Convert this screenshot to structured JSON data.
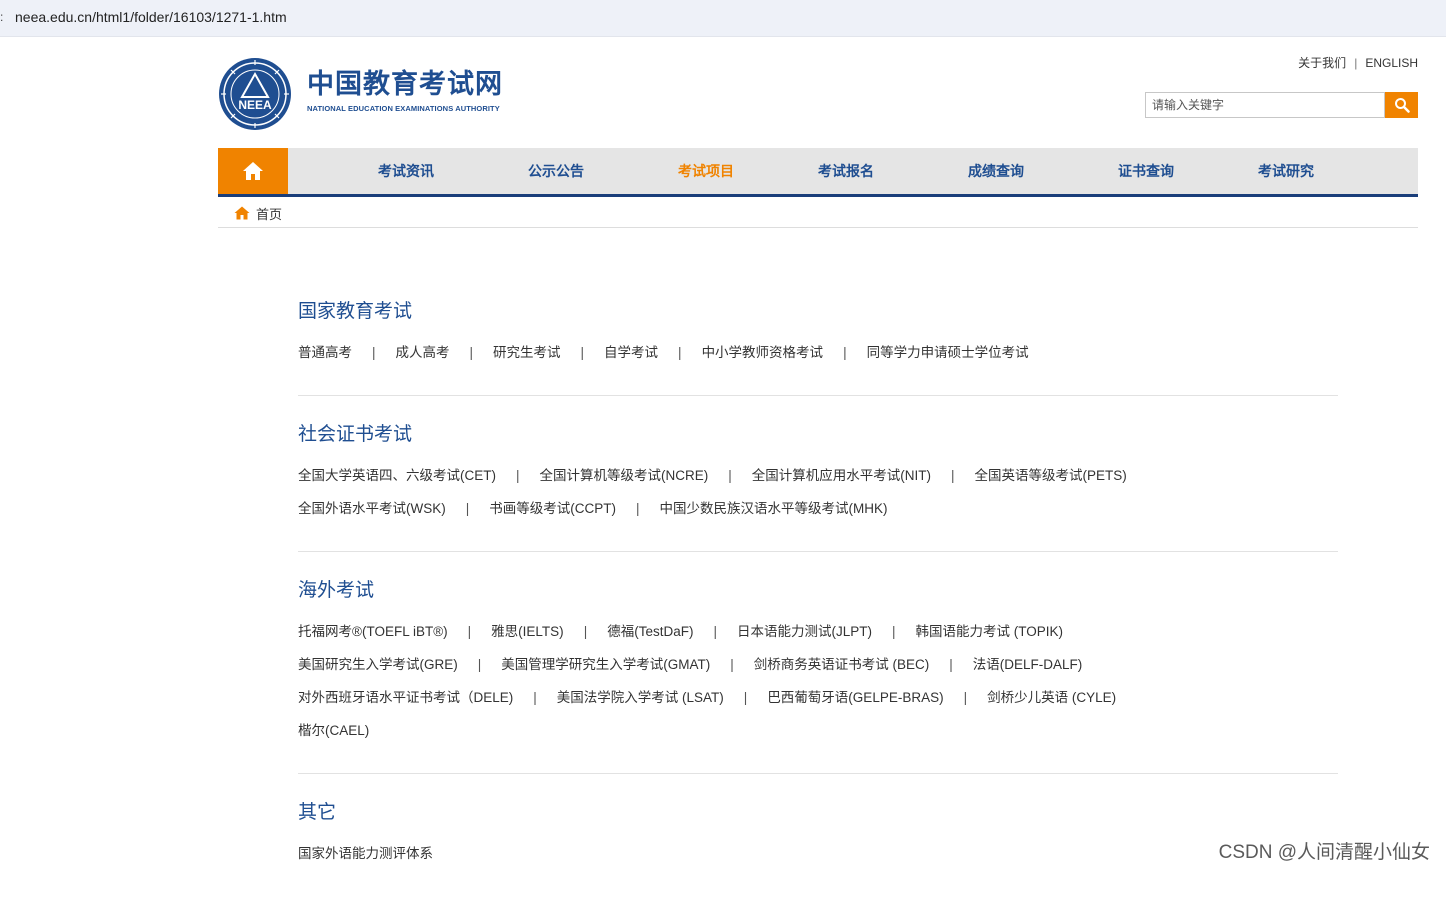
{
  "browser": {
    "url": "neea.edu.cn/html1/folder/16103/1271-1.htm"
  },
  "header": {
    "logo_cn": "中国教育考试网",
    "logo_en": "NATIONAL EDUCATION EXAMINATIONS AUTHORITY",
    "emblem_letters": "NEEA",
    "links": {
      "about": "关于我们",
      "separator": "|",
      "english": "ENGLISH"
    },
    "search": {
      "placeholder": "请输入关键字"
    }
  },
  "nav": {
    "items": [
      {
        "label": "考试资讯"
      },
      {
        "label": "公示公告"
      },
      {
        "label": "考试项目",
        "active": true
      },
      {
        "label": "考试报名"
      },
      {
        "label": "成绩查询"
      },
      {
        "label": "证书查询"
      },
      {
        "label": "考试研究"
      }
    ]
  },
  "breadcrumb": {
    "home": "首页"
  },
  "sections": [
    {
      "title": "国家教育考试",
      "rows": [
        [
          "普通高考",
          "成人高考",
          "研究生考试",
          "自学考试",
          "中小学教师资格考试",
          "同等学力申请硕士学位考试"
        ]
      ]
    },
    {
      "title": "社会证书考试",
      "rows": [
        [
          "全国大学英语四、六级考试(CET)",
          "全国计算机等级考试(NCRE)",
          "全国计算机应用水平考试(NIT)",
          "全国英语等级考试(PETS)"
        ],
        [
          "全国外语水平考试(WSK)",
          "书画等级考试(CCPT)",
          "中国少数民族汉语水平等级考试(MHK)"
        ]
      ]
    },
    {
      "title": "海外考试",
      "rows": [
        [
          "托福网考®(TOEFL iBT®)",
          "雅思(IELTS)",
          "德福(TestDaF)",
          "日本语能力测试(JLPT)",
          "韩国语能力考试 (TOPIK)"
        ],
        [
          "美国研究生入学考试(GRE)",
          "美国管理学研究生入学考试(GMAT)",
          "剑桥商务英语证书考试 (BEC)",
          "法语(DELF-DALF)"
        ],
        [
          "对外西班牙语水平证书考试（DELE)",
          "美国法学院入学考试 (LSAT)",
          "巴西葡萄牙语(GELPE-BRAS)",
          "剑桥少儿英语 (CYLE)"
        ],
        [
          "楷尔(CAEL)"
        ]
      ]
    },
    {
      "title": "其它",
      "rows": [
        [
          "国家外语能力测评体系"
        ]
      ]
    }
  ],
  "link_separator": "|",
  "watermark": "CSDN @人间清醒小仙女",
  "colors": {
    "brand_blue": "#1f4e91",
    "accent_orange": "#f08300",
    "nav_bg": "#e5e5e5",
    "nav_border": "#1a3e7a"
  },
  "icons": {
    "search": "search-icon",
    "home": "home-icon",
    "breadcrumb": "home-icon"
  }
}
